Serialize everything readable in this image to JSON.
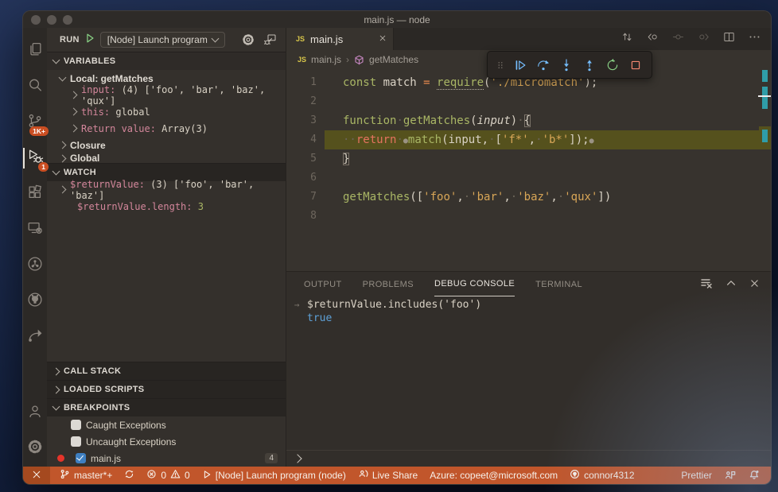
{
  "window": {
    "title": "main.js — node"
  },
  "colors": {
    "statusbar": "#c1562b",
    "badge": "#ca4e22",
    "current_line": "#55511d",
    "debug_blue": "#75beff",
    "debug_green": "#89d185",
    "debug_red": "#f48771",
    "string_yellow": "#d8a657",
    "keyword_green": "#a9b665",
    "return_red": "#e5735f",
    "watch_key_purple": "#d3869b",
    "overview_teal": "#2f9da8"
  },
  "activity_bar": {
    "scm_badge": "1K+",
    "debug_badge": "1"
  },
  "run_bar": {
    "label": "RUN",
    "config": "[Node] Launch program"
  },
  "variables": {
    "title": "VARIABLES",
    "rows": [
      {
        "label": "Local: getMatches"
      },
      {
        "key": "input:",
        "value": " (4) ['foo', 'bar', 'baz', 'qux']"
      },
      {
        "key": "this:",
        "value": " global"
      },
      {
        "key": "Return value:",
        "value": " Array(3)"
      },
      {
        "label": "Closure"
      },
      {
        "label": "Global"
      }
    ]
  },
  "watch": {
    "title": "WATCH",
    "rows": [
      {
        "key": "$returnValue:",
        "value": " (3) ['foo', 'bar', 'baz']"
      },
      {
        "key": "$returnValue.length:",
        "value_green": "3"
      }
    ]
  },
  "bottom_sections": {
    "call_stack": "CALL STACK",
    "loaded_scripts": "LOADED SCRIPTS",
    "breakpoints": "BREAKPOINTS",
    "rows": [
      {
        "label": "Caught Exceptions",
        "checked": false
      },
      {
        "label": "Uncaught Exceptions",
        "checked": false
      },
      {
        "label": "main.js",
        "checked": true,
        "badge": "4"
      }
    ]
  },
  "editor": {
    "tab": {
      "js_badge": "JS",
      "title": "main.js"
    },
    "breadcrumbs": {
      "js_badge": "JS",
      "file": "main.js",
      "symbol": "getMatches"
    }
  },
  "code": {
    "lines": [
      {
        "n": "1",
        "tokens": [
          {
            "t": "const ",
            "c": "g"
          },
          {
            "t": "match ",
            "c": "w"
          },
          {
            "t": "= ",
            "c": "o"
          },
          {
            "t": "require",
            "c": "gu"
          },
          {
            "t": "(",
            "c": "w"
          },
          {
            "t": "'./micromatch'",
            "c": "y"
          },
          {
            "t": ");",
            "c": "w"
          }
        ]
      },
      {
        "n": "2",
        "tokens": []
      },
      {
        "n": "3",
        "tokens": [
          {
            "t": "function",
            "c": "g"
          },
          {
            "t": "·",
            "c": "ws"
          },
          {
            "t": "getMatches",
            "c": "g"
          },
          {
            "t": "(",
            "c": "w"
          },
          {
            "t": "input",
            "c": "i"
          },
          {
            "t": ")",
            "c": "w"
          },
          {
            "t": "·",
            "c": "ws"
          },
          {
            "t": "{",
            "c": "b"
          }
        ]
      },
      {
        "n": "4",
        "current": true,
        "tokens": [
          {
            "t": "··",
            "c": "ws"
          },
          {
            "t": "return",
            "c": "r"
          },
          {
            "t": "·",
            "c": "ws"
          },
          {
            "t": "●",
            "c": "d"
          },
          {
            "t": "match",
            "c": "g"
          },
          {
            "t": "(input,",
            "c": "w"
          },
          {
            "t": "·",
            "c": "ws"
          },
          {
            "t": "[",
            "c": "w"
          },
          {
            "t": "'f*'",
            "c": "y"
          },
          {
            "t": ",",
            "c": "w"
          },
          {
            "t": "·",
            "c": "ws"
          },
          {
            "t": "'b*'",
            "c": "y"
          },
          {
            "t": "]);",
            "c": "w"
          },
          {
            "t": "●",
            "c": "d"
          }
        ]
      },
      {
        "n": "5",
        "tokens": [
          {
            "t": "}",
            "c": "b"
          }
        ]
      },
      {
        "n": "6",
        "tokens": []
      },
      {
        "n": "7",
        "tokens": [
          {
            "t": "getMatches",
            "c": "g"
          },
          {
            "t": "([",
            "c": "w"
          },
          {
            "t": "'foo'",
            "c": "y"
          },
          {
            "t": ",",
            "c": "w"
          },
          {
            "t": "·",
            "c": "ws"
          },
          {
            "t": "'bar'",
            "c": "y"
          },
          {
            "t": ",",
            "c": "w"
          },
          {
            "t": "·",
            "c": "ws"
          },
          {
            "t": "'baz'",
            "c": "y"
          },
          {
            "t": ",",
            "c": "w"
          },
          {
            "t": "·",
            "c": "ws"
          },
          {
            "t": "'qux'",
            "c": "y"
          },
          {
            "t": "])",
            "c": "w"
          }
        ]
      },
      {
        "n": "8",
        "tokens": []
      }
    ]
  },
  "panel": {
    "tabs": [
      "OUTPUT",
      "PROBLEMS",
      "DEBUG CONSOLE",
      "TERMINAL"
    ],
    "active_tab": "DEBUG CONSOLE",
    "console": {
      "arrow_glyph": "→",
      "expr": "$returnValue.includes('foo')",
      "result": "true"
    }
  },
  "statusbar": {
    "branch": "master*+",
    "errors": "0",
    "warnings": "0",
    "launch": "[Node] Launch program (node)",
    "live_share": "Live Share",
    "azure": "Azure: copeet@microsoft.com",
    "github_user": "connor4312",
    "prettier": "Prettier"
  }
}
